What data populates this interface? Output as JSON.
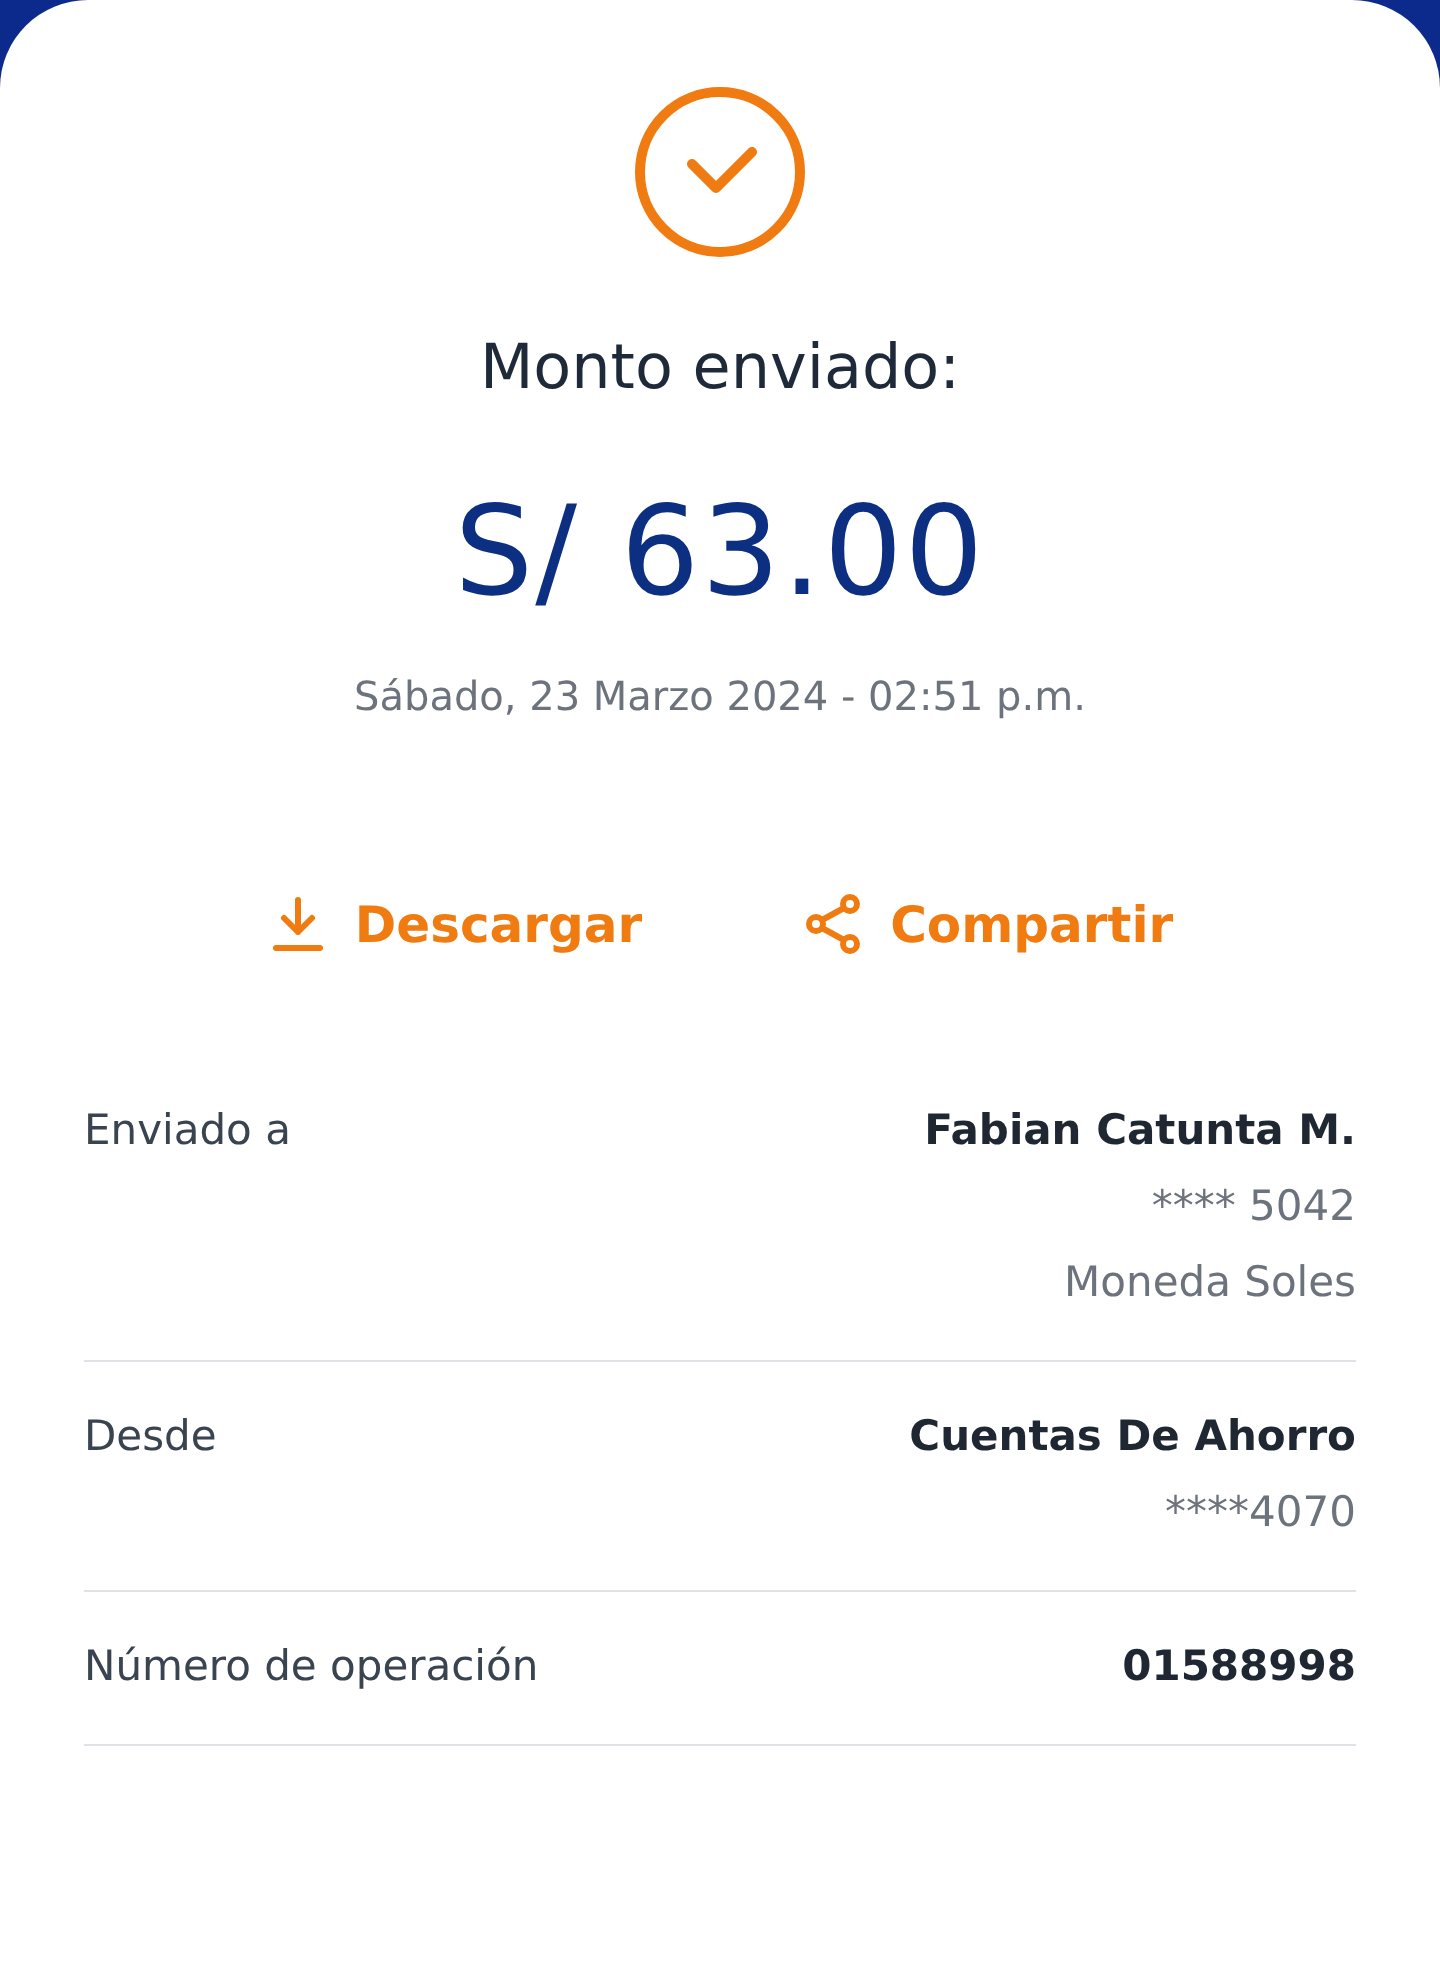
{
  "title": "Monto enviado:",
  "amount": "S/ 63.00",
  "date": "Sábado, 23 Marzo 2024 - 02:51 p.m.",
  "actions": [
    {
      "kind": "download",
      "label": "Descargar"
    },
    {
      "kind": "share",
      "label": "Compartir"
    }
  ],
  "details": [
    {
      "label": "Enviado a",
      "values": [
        {
          "kind": "primary",
          "text": "Fabian Catunta M."
        },
        {
          "kind": "secondary",
          "text": "**** 5042"
        },
        {
          "kind": "secondary",
          "text": "Moneda Soles"
        }
      ]
    },
    {
      "label": "Desde",
      "values": [
        {
          "kind": "primary",
          "text": "Cuentas De Ahorro"
        },
        {
          "kind": "secondary",
          "text": "****4070"
        }
      ]
    },
    {
      "label": "Número de operación",
      "values": [
        {
          "kind": "primary",
          "text": "01588998"
        }
      ]
    }
  ]
}
